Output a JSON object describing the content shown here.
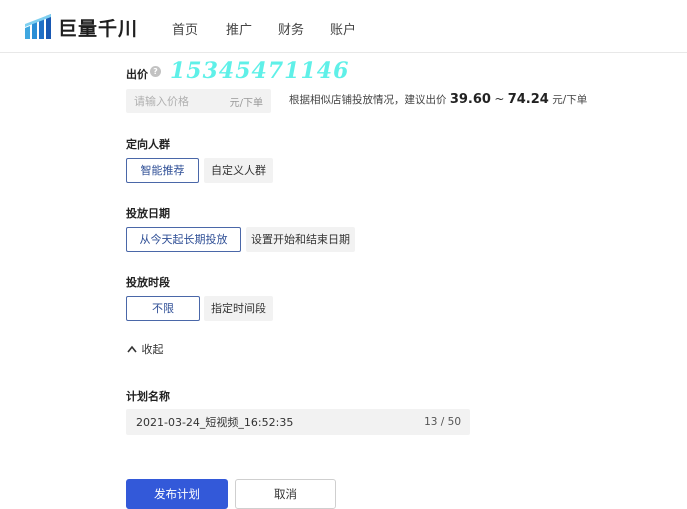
{
  "header": {
    "brand": "巨量千川",
    "nav": [
      {
        "label": "首页"
      },
      {
        "label": "推广"
      },
      {
        "label": "财务"
      },
      {
        "label": "账户"
      }
    ]
  },
  "bid": {
    "label": "出价",
    "help_icon": "?",
    "watermark": "15345471146",
    "placeholder": "请输入价格",
    "unit": "元/下单",
    "suggest_prefix": "根据相似店铺投放情况，建议出价",
    "suggest_min": "39.60",
    "suggest_sep": "~",
    "suggest_max": "74.24",
    "suggest_unit": "元/下单"
  },
  "audience": {
    "label": "定向人群",
    "options": [
      {
        "label": "智能推荐",
        "selected": true
      },
      {
        "label": "自定义人群",
        "selected": false
      }
    ]
  },
  "date": {
    "label": "投放日期",
    "options": [
      {
        "label": "从今天起长期投放",
        "selected": true
      },
      {
        "label": "设置开始和结束日期",
        "selected": false
      }
    ]
  },
  "time": {
    "label": "投放时段",
    "options": [
      {
        "label": "不限",
        "selected": true
      },
      {
        "label": "指定时间段",
        "selected": false
      }
    ]
  },
  "collapse": {
    "label": "收起",
    "icon": "chevron-up-icon"
  },
  "plan_name": {
    "label": "计划名称",
    "value": "2021-03-24_短视频_16:52:35",
    "count": "13 / 50"
  },
  "actions": {
    "publish": "发布计划",
    "cancel": "取消"
  },
  "colors": {
    "primary": "#3359d9",
    "active_border": "#4a67a8",
    "watermark": "#5ff0e8"
  }
}
